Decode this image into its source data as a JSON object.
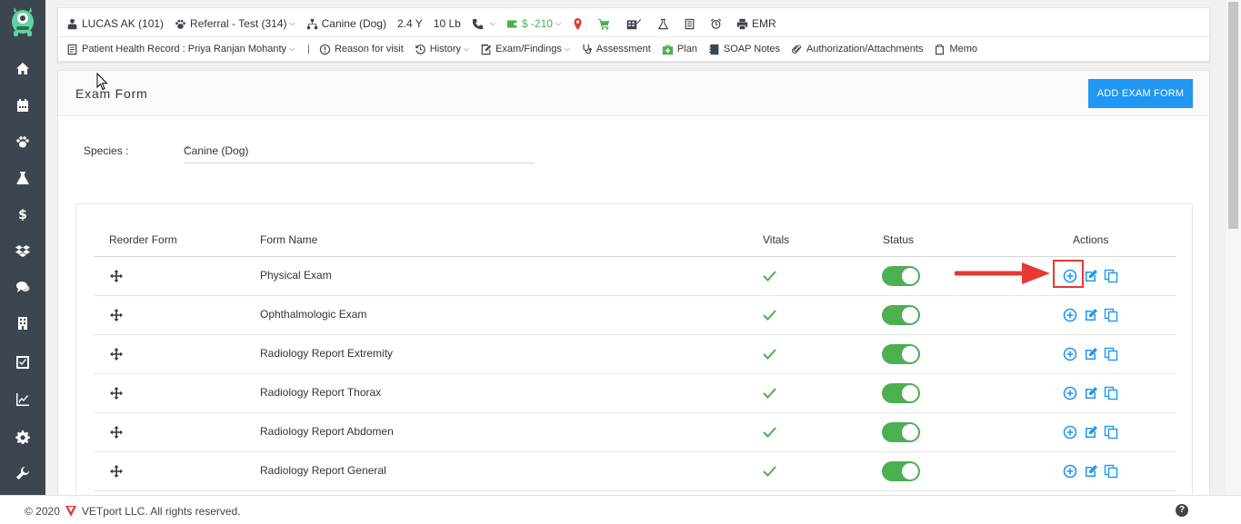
{
  "header": {
    "patient": "LUCAS AK (101)",
    "referral": "Referral - Test (314)",
    "species": "Canine (Dog)",
    "age": "2.4 Y",
    "weight": "10 Lb",
    "balance": "$ -210",
    "emr": "EMR"
  },
  "nav": {
    "health_record": "Patient Health Record : Priya Ranjan Mohanty",
    "separator": "|",
    "reason": "Reason for visit",
    "history": "History",
    "exam": "Exam/Findings",
    "assessment": "Assessment",
    "plan": "Plan",
    "soap": "SOAP Notes",
    "authorization": "Authorization/Attachments",
    "memo": "Memo"
  },
  "panel": {
    "title": "Exam Form",
    "add_button": "ADD EXAM FORM",
    "species_label": "Species :",
    "species_value": "Canine (Dog)"
  },
  "table": {
    "headers": {
      "reorder": "Reorder Form",
      "name": "Form Name",
      "vitals": "Vitals",
      "status": "Status",
      "actions": "Actions"
    },
    "rows": [
      {
        "name": "Physical Exam"
      },
      {
        "name": "Ophthalmologic Exam"
      },
      {
        "name": "Radiology Report Extremity"
      },
      {
        "name": "Radiology Report Thorax"
      },
      {
        "name": "Radiology Report Abdomen"
      },
      {
        "name": "Radiology Report General"
      }
    ]
  },
  "footer": {
    "copyright": "© 2020",
    "company": "VETport LLC. All rights reserved.",
    "help": "?"
  },
  "colors": {
    "sidebar": "#3d4550",
    "primary": "#2196f3",
    "success": "#4caf50",
    "highlight": "#e53935"
  }
}
